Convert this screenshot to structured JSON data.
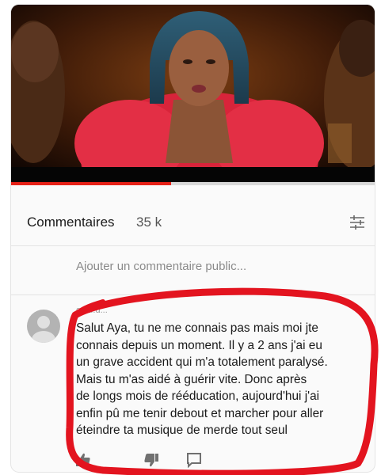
{
  "comments": {
    "title": "Commentaires",
    "count": "35 k",
    "add_placeholder": "Ajouter un commentaire public..."
  },
  "video": {
    "progress": 0.44
  },
  "comment": {
    "author": "o?af.d...",
    "text": "Salut Aya, tu ne me connais pas mais moi jte\nconnais depuis un moment. Il y a 2 ans j'ai eu\nun grave accident qui m'a totalement paralysé.\nMais tu m'as aidé à guérir vite. Donc après\nde longs mois de rééducation, aujourd'hui j'ai\nenfin pû me tenir debout et marcher pour aller\néteindre ta musique de merde tout seul"
  },
  "icons": {
    "filter": "filter-sliders-icon",
    "like": "thumbs-up-icon",
    "dislike": "thumbs-down-icon",
    "reply": "reply-comment-icon"
  },
  "colors": {
    "highlight": "#e3141f",
    "progress": "#e62117"
  }
}
